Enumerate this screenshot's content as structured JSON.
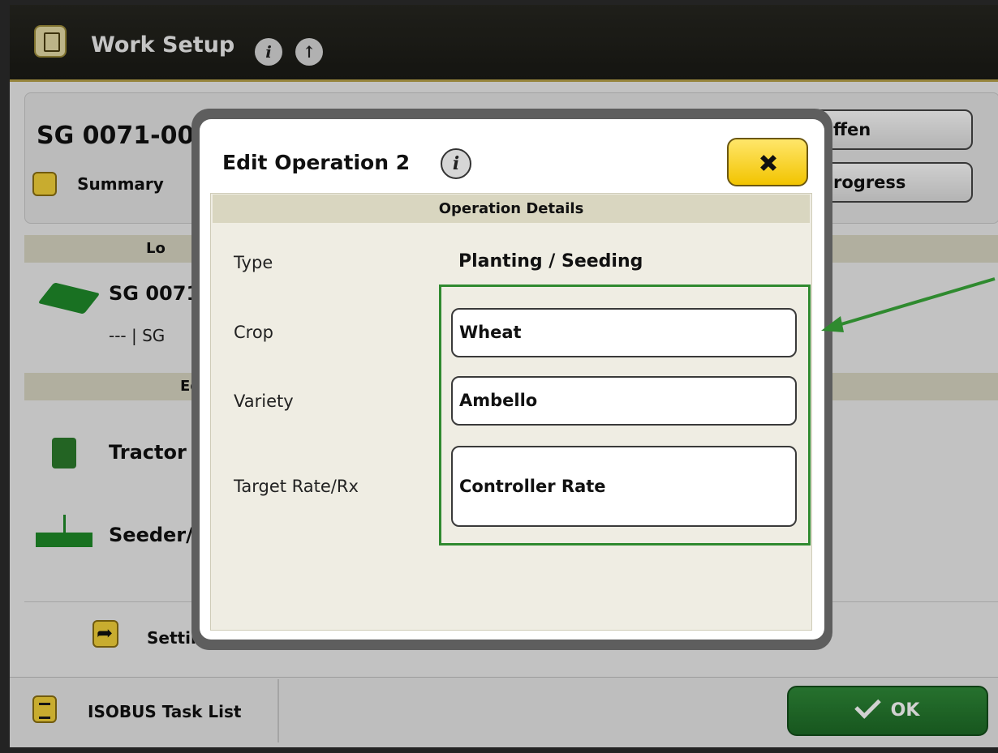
{
  "header": {
    "title": "Work Setup",
    "info_icon": "info-icon",
    "help_icon": "upload-icon"
  },
  "background": {
    "job_name": "SG 0071-00",
    "summary_label": "Summary",
    "right_button_1": "ffen",
    "right_button_2": "rogress",
    "location_header": "Lo",
    "location_name": "SG 0071",
    "location_sub": "--- | SG",
    "equipment_header": "Equi",
    "tractor_label": "Tractor",
    "seeder_label": "Seeder/",
    "settings_label": "Settings Manager"
  },
  "footer": {
    "task_list_label": "ISOBUS Task List",
    "ok_label": "OK"
  },
  "dialog": {
    "title": "Edit Operation 2",
    "section_header": "Operation Details",
    "fields": [
      {
        "label": "Type",
        "value": "Planting / Seeding"
      },
      {
        "label": "Crop",
        "value": "Wheat"
      },
      {
        "label": "Variety",
        "value": "Ambello"
      },
      {
        "label": "Target Rate/Rx",
        "value": "Controller Rate"
      }
    ]
  },
  "colors": {
    "accent_green": "#2f8a38",
    "highlight_green": "#2f8a2f",
    "button_yellow": "#f4d23a",
    "panel_beige": "#efede3"
  }
}
